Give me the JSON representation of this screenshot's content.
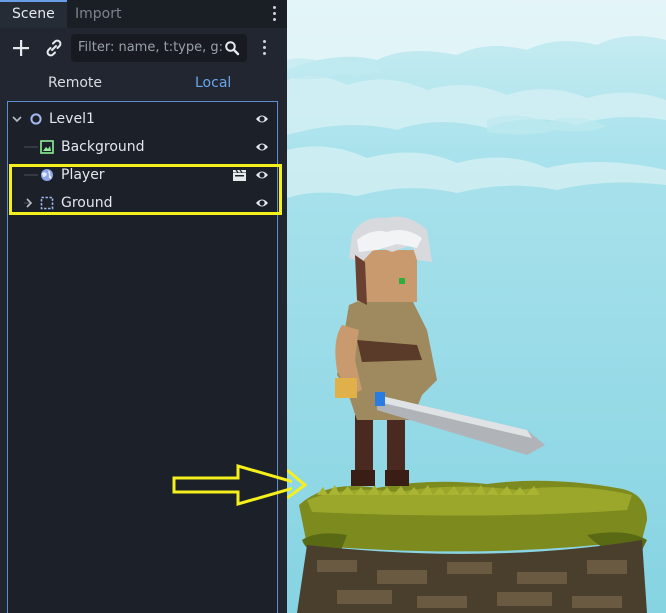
{
  "tabs": [
    {
      "label": "Scene",
      "active": true
    },
    {
      "label": "Import",
      "active": false
    }
  ],
  "toolbar": {
    "add_icon": "plus-icon",
    "link_icon": "link-icon",
    "filter_placeholder": "Filter: name, t:type, g:",
    "search_icon": "search-icon",
    "menu_icon": "kebab-menu-icon"
  },
  "tree_mode": {
    "remote": "Remote",
    "local": "Local",
    "selected": "Local"
  },
  "tree": [
    {
      "label": "Level1",
      "icon": "node-circle-icon",
      "expanded": true,
      "visible": true
    },
    {
      "label": "Background",
      "icon": "texture-rect-icon",
      "visible": true
    },
    {
      "label": "Player",
      "icon": "character-globe-icon",
      "has_scene_badge": true,
      "visible": true
    },
    {
      "label": "Ground",
      "icon": "area-rect-icon",
      "expanded": false,
      "visible": true
    }
  ],
  "colors": {
    "accent": "#6a9de8",
    "highlight": "#f5f01c",
    "panel_bg": "#212630",
    "sky": "#8fd6e4"
  }
}
